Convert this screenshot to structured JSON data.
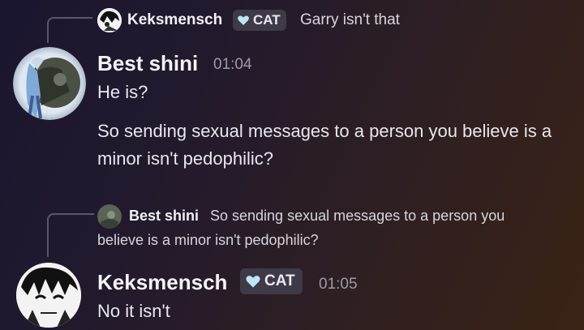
{
  "first_block": {
    "reply": {
      "author": "Keksmensch",
      "tag": "CAT",
      "text": "Garry isn't that"
    },
    "author": "Best shini",
    "time": "01:04",
    "messages": [
      "He is?",
      "So sending sexual messages to a person you believe is a minor isn't pedophilic?"
    ]
  },
  "second_block": {
    "reply": {
      "author": "Best shini",
      "text_line1": "So sending sexual messages to a person you",
      "text_line2": "believe is a minor isn't pedophilic?"
    },
    "author": "Keksmensch",
    "tag": "CAT",
    "time": "01:05",
    "messages": [
      "No it isn't"
    ]
  },
  "colors": {
    "tag_bg": "#3e3a47",
    "heart": "#bfe6f5",
    "muted": "#9e99a8"
  },
  "icons": {
    "tag_icon": "heart-icon"
  }
}
